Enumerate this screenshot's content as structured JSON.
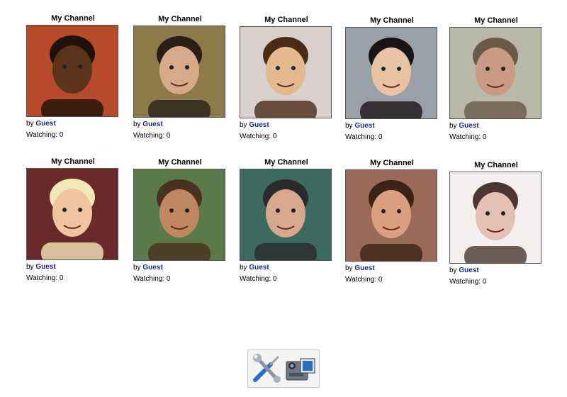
{
  "channels": [
    {
      "title": "My Channel",
      "by": "by",
      "user": "Guest",
      "watching": "Watching: 0",
      "photo": "boy-glasses-photo",
      "bg": "#b74a2a",
      "skin": "#5a3519",
      "hair": "#1e120a"
    },
    {
      "title": "My Channel",
      "by": "by",
      "user": "Guest",
      "watching": "Watching: 0",
      "photo": "man-smiling-photo",
      "bg": "#8c7a4a",
      "skin": "#d6a98a",
      "hair": "#2a2018"
    },
    {
      "title": "My Channel",
      "by": "by",
      "user": "Guest",
      "watching": "Watching: 0",
      "photo": "dog-costume-photo",
      "bg": "#d7d0cc",
      "skin": "#e3b88a",
      "hair": "#4a2b18"
    },
    {
      "title": "My Channel",
      "by": "by",
      "user": "Guest",
      "watching": "Watching: 0",
      "photo": "woman-flowers-photo",
      "bg": "#9aa0a8",
      "skin": "#e8c3a3",
      "hair": "#1a1416"
    },
    {
      "title": "My Channel",
      "by": "by",
      "user": "Guest",
      "watching": "Watching: 0",
      "photo": "man-headphones-photo",
      "bg": "#b8b8a8",
      "skin": "#c99a84",
      "hair": "#6a5a48"
    },
    {
      "title": "My Channel",
      "by": "by",
      "user": "Guest",
      "watching": "Watching: 0",
      "photo": "woman-car-photo",
      "bg": "#6b2a2a",
      "skin": "#f0c4a0",
      "hair": "#f2e7b6"
    },
    {
      "title": "My Channel",
      "by": "by",
      "user": "Guest",
      "watching": "Watching: 0",
      "photo": "man-cigar-photo",
      "bg": "#5a7a4a",
      "skin": "#c08860",
      "hair": "#4a3220"
    },
    {
      "title": "My Channel",
      "by": "by",
      "user": "Guest",
      "watching": "Watching: 0",
      "photo": "men-drinking-photo",
      "bg": "#3c6a5e",
      "skin": "#d8a88c",
      "hair": "#2b2b2b"
    },
    {
      "title": "My Channel",
      "by": "by",
      "user": "Guest",
      "watching": "Watching: 0",
      "photo": "couple-sunglasses-photo",
      "bg": "#9a6a58",
      "skin": "#d8a080",
      "hair": "#3a2418"
    },
    {
      "title": "My Channel",
      "by": "by",
      "user": "Guest",
      "watching": "Watching: 0",
      "photo": "man-portrait-photo",
      "bg": "#f2efee",
      "skin": "#e4c0b4",
      "hair": "#4a3830"
    }
  ],
  "toolbar": {
    "settings_icon": "tools-icon",
    "camera_icon": "video-camera-icon"
  }
}
